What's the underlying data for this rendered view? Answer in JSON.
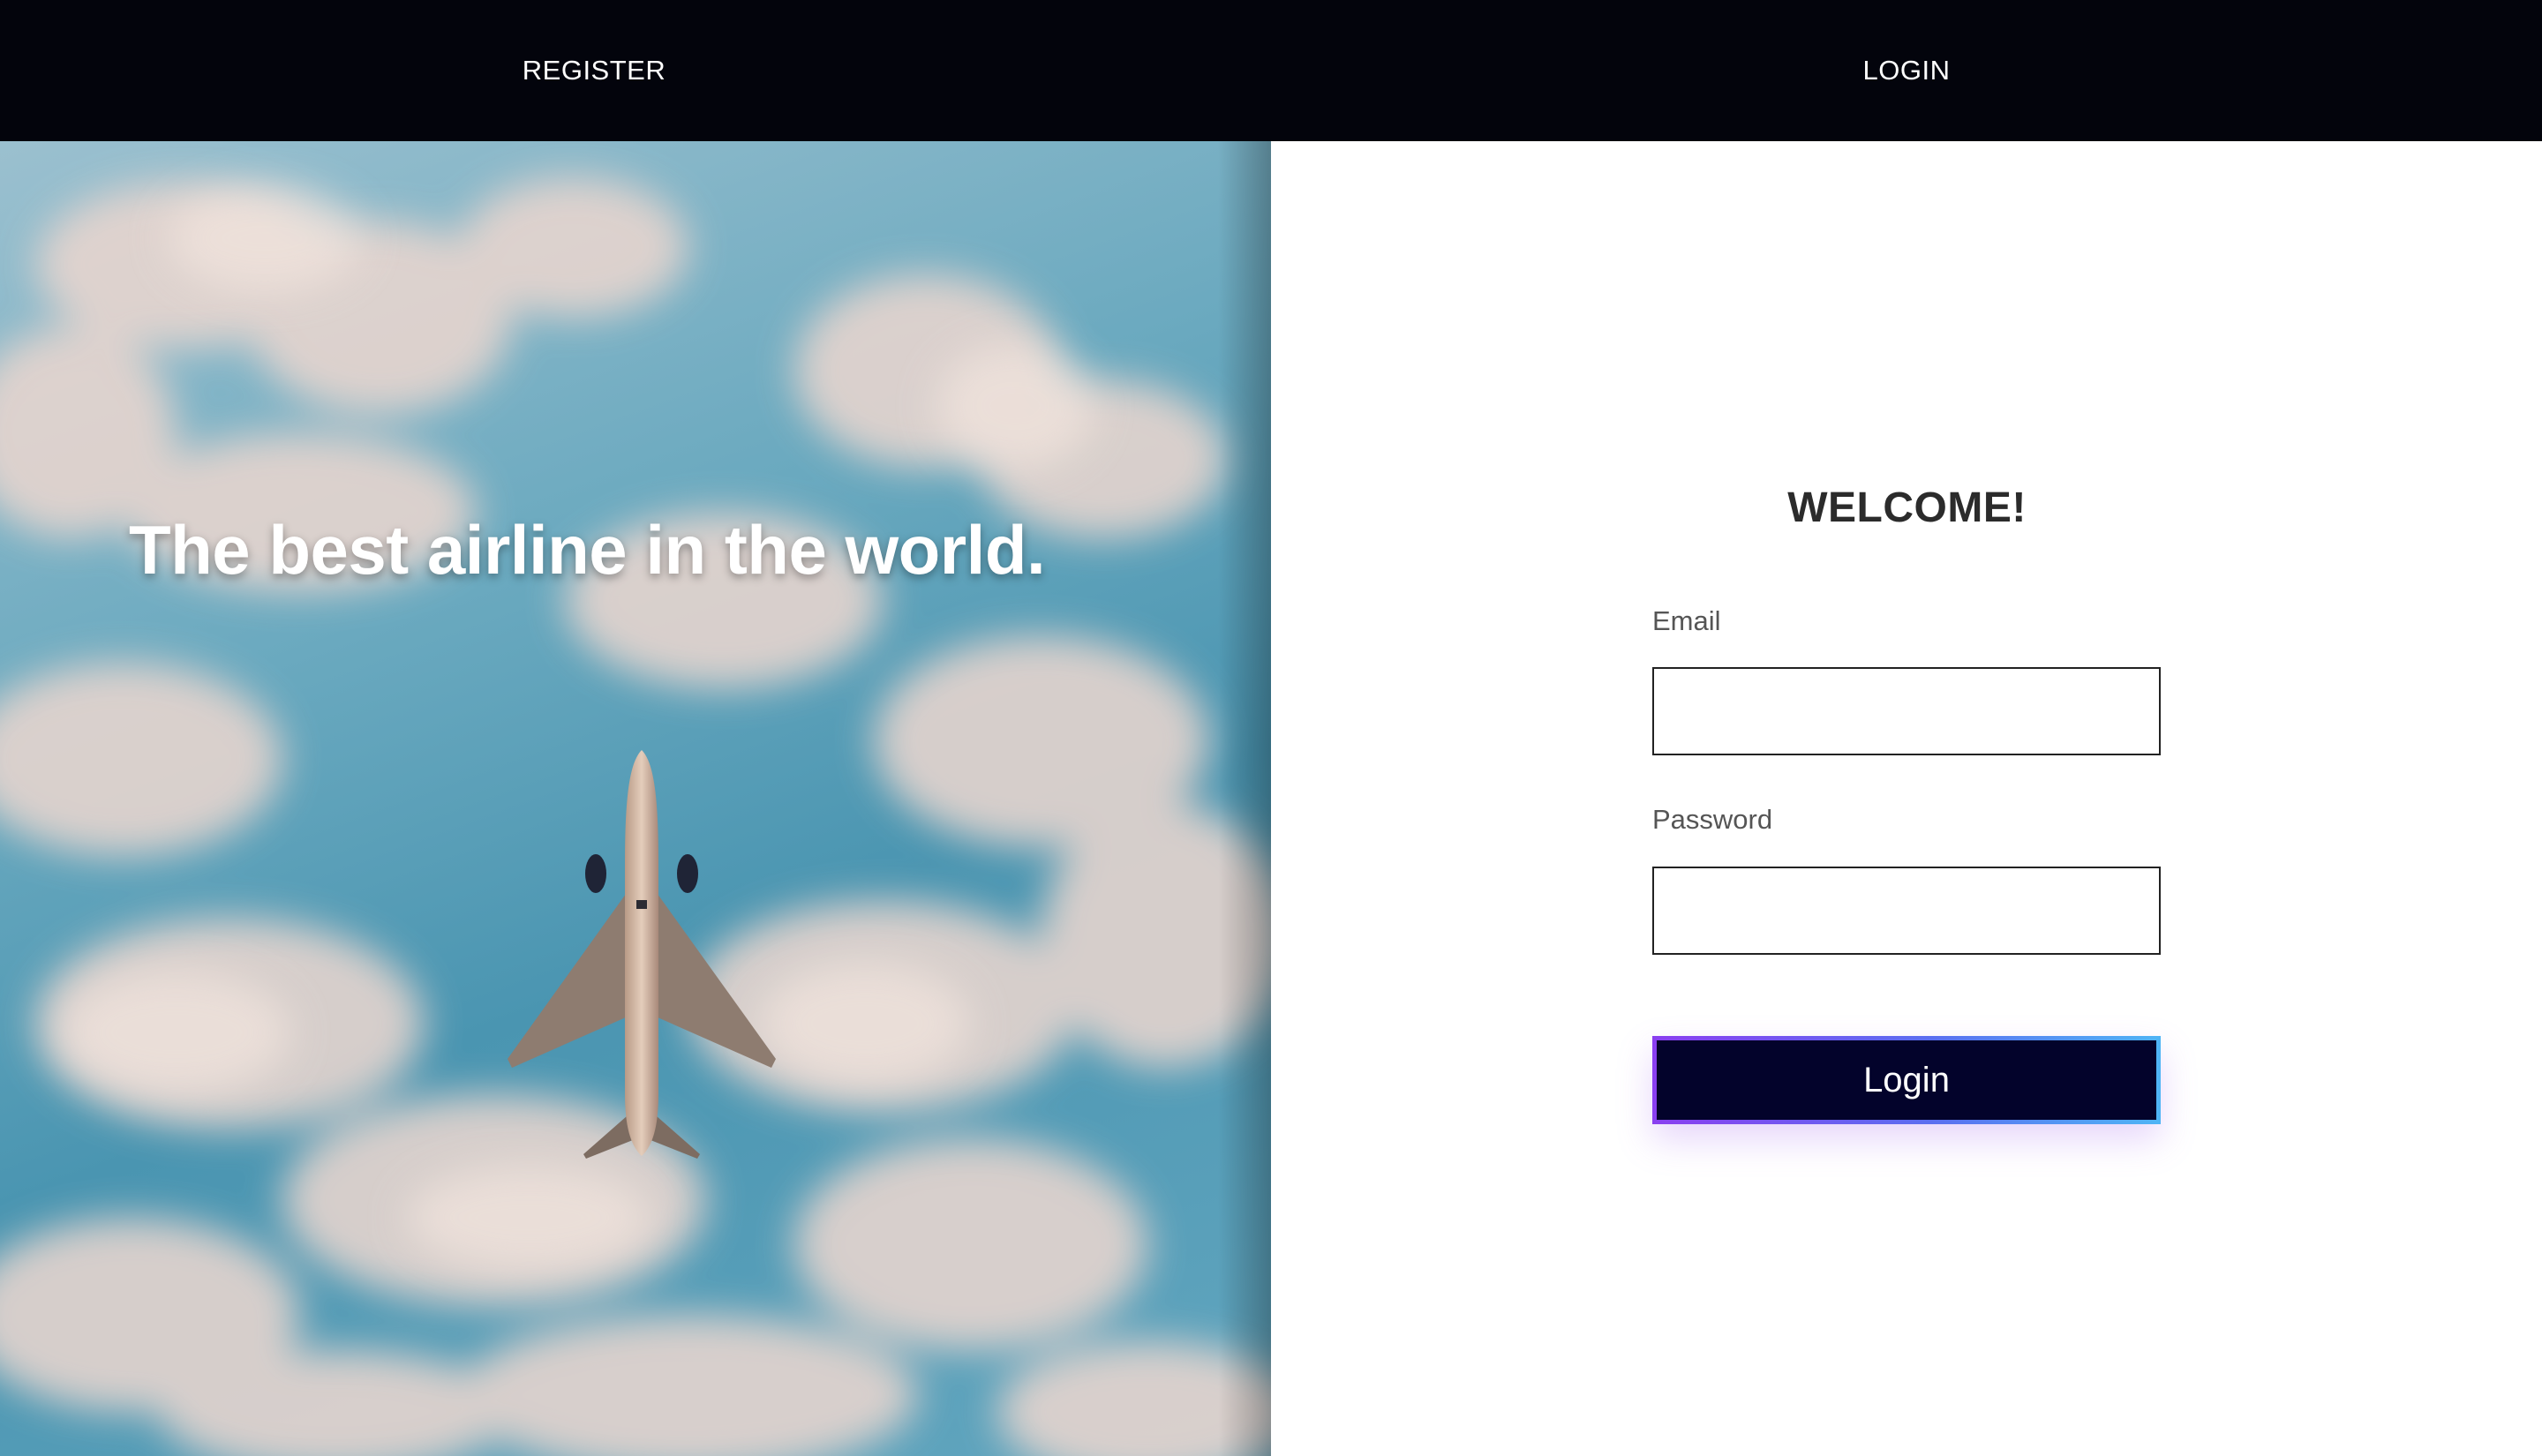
{
  "nav": {
    "register_label": "REGISTER",
    "login_label": "LOGIN"
  },
  "hero": {
    "title": "The best airline in the world."
  },
  "login_form": {
    "heading": "WELCOME!",
    "email_label": "Email",
    "email_value": "",
    "password_label": "Password",
    "password_value": "",
    "submit_label": "Login"
  },
  "colors": {
    "nav_background": "#03040c",
    "button_background": "#03032b",
    "button_border_start": "#8a3ff0",
    "button_border_end": "#4fb5f5",
    "sky": "#4a95b1"
  }
}
